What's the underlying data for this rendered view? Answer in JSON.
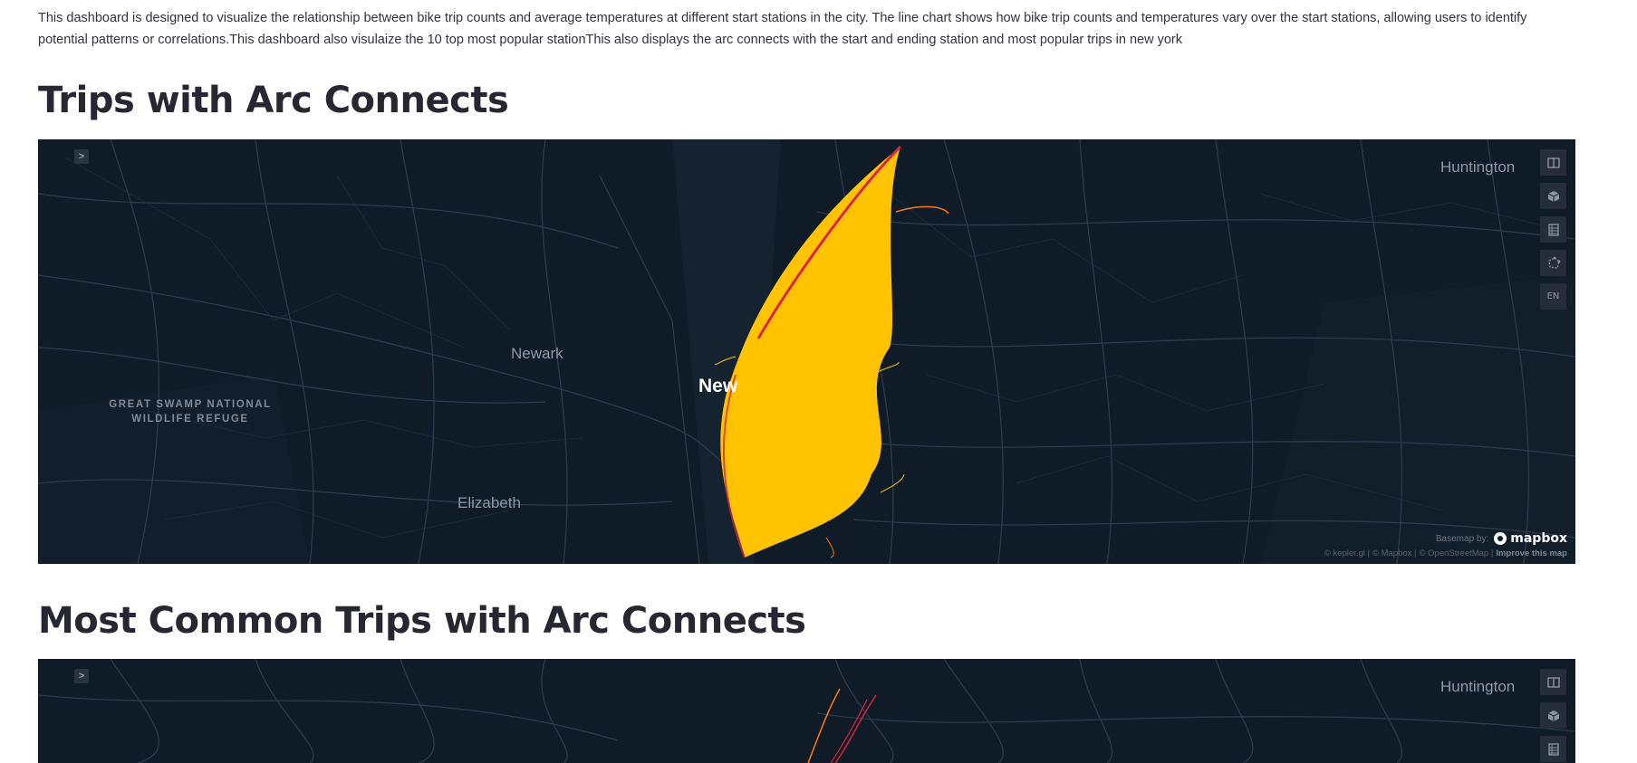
{
  "intro": "This dashboard is designed to visualize the relationship between bike trip counts and average temperatures at different start stations in the city. The line chart shows how bike trip counts and temperatures vary over the start stations, allowing users to identify potential patterns or correlations.This dashboard also visulaize the 10 top most popular stationThis also displays the arc connects with the start and ending station and most popular trips in new york",
  "sections": [
    {
      "title": "Trips with Arc Connects",
      "map": {
        "panel_toggle": ">",
        "controls": [
          {
            "icon": "split-map-icon",
            "label": ""
          },
          {
            "icon": "3d-cube-icon",
            "label": ""
          },
          {
            "icon": "legend-table-icon",
            "label": ""
          },
          {
            "icon": "draw-polygon-icon",
            "label": ""
          },
          {
            "icon": "locale-icon",
            "label": "EN"
          }
        ],
        "places": {
          "huntington": "Huntington",
          "newark": "Newark",
          "new_york": "New",
          "elizabeth": "Elizabeth",
          "great_swamp": "GREAT SWAMP NATIONAL WILDLIFE REFUGE"
        },
        "basemap_label": "Basemap by:",
        "basemap_brand": "mapbox",
        "attribution": {
          "kepler": "© kepler.gl |",
          "mapbox": "© Mapbox |",
          "osm": "© OpenStreetMap |",
          "improve": "Improve this map"
        },
        "arc_colors": {
          "primary": "#ffc300",
          "secondary": "#d7263d",
          "orange": "#ff7a1a"
        }
      }
    },
    {
      "title": "Most Common Trips with Arc Connects",
      "map": {
        "panel_toggle": ">",
        "controls": [
          {
            "icon": "split-map-icon",
            "label": ""
          },
          {
            "icon": "3d-cube-icon",
            "label": ""
          },
          {
            "icon": "legend-table-icon",
            "label": ""
          }
        ],
        "places": {
          "huntington": "Huntington"
        },
        "arc_colors": {
          "primary": "#ff7a1a",
          "secondary": "#d7263d"
        }
      }
    }
  ]
}
